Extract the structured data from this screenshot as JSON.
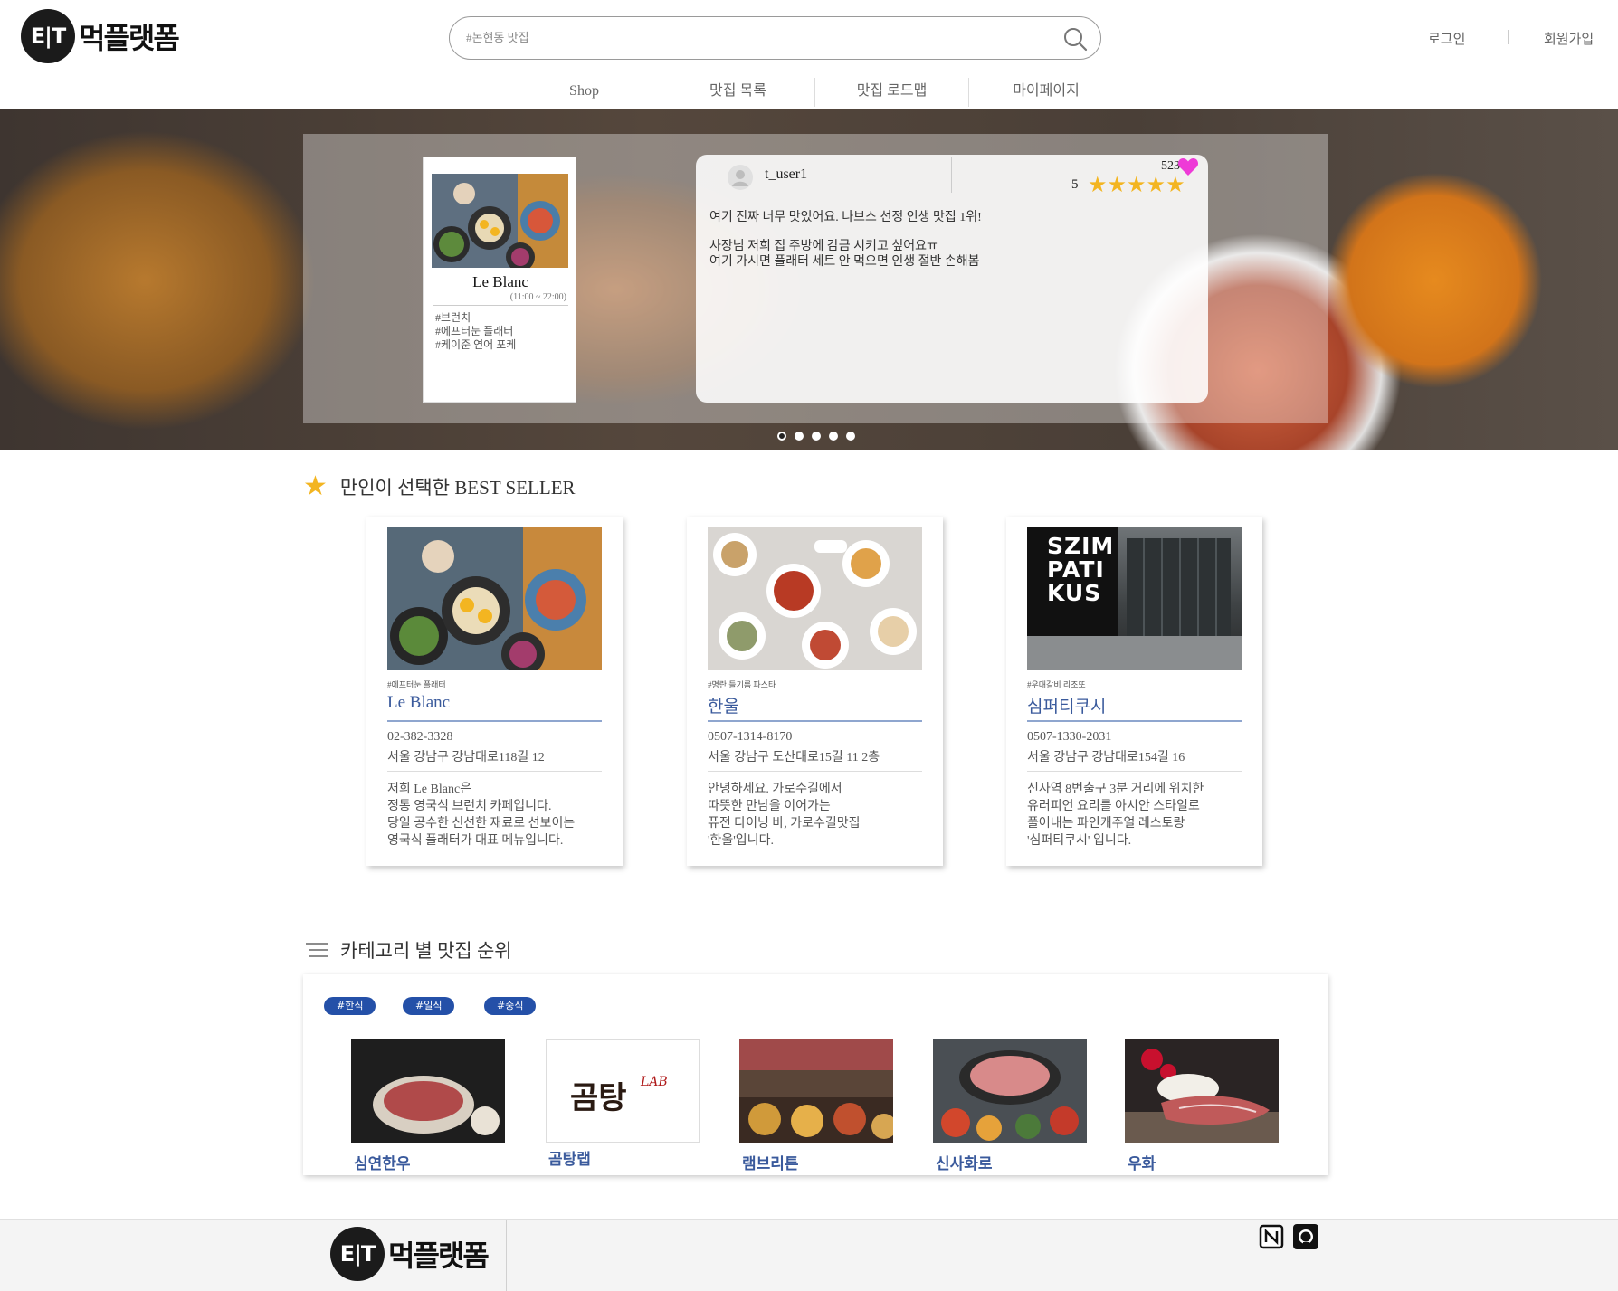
{
  "header": {
    "logo_mark": "E|T",
    "logo_text": "먹플랫폼",
    "search_placeholder": "#논현동 맛집",
    "login": "로그인",
    "signup": "회원가입",
    "nav": [
      "Shop",
      "맛집 목록",
      "맛집 로드맵",
      "마이페이지"
    ]
  },
  "hero": {
    "card": {
      "name": "Le Blanc",
      "hours": "(11:00 ~ 22:00)",
      "tags": [
        "#브런치",
        "#에프터눈 플래터",
        "#케이준 연어 포케"
      ]
    },
    "review": {
      "user": "t_user1",
      "likes": "523",
      "score": "5",
      "stars": 5,
      "lines": [
        "여기 진짜 너무 맛있어요. 나브스 선정 인생 맛집 1위!",
        "사장님 저희 집 주방에 감금 시키고 싶어요ㅠ\n여기 가시면 플래터 세트 안 먹으면 인생 절반 손해봄"
      ]
    },
    "slides": 5,
    "active_slide": 0
  },
  "best_seller": {
    "title": "만인이 선택한 BEST SELLER",
    "cards": [
      {
        "tag": "#에프터눈 플래터",
        "name": "Le Blanc",
        "phone": "02-382-3328",
        "address": "서울 강남구 강남대로118길 12",
        "desc": "저희 Le Blanc은\n정통 영국식 브런치 카페입니다.\n당일 공수한 신선한 재료로 선보이는\n영국식 플래터가 대표 메뉴입니다."
      },
      {
        "tag": "#명란 들기름 파스타",
        "name": "한울",
        "phone": "0507-1314-8170",
        "address": "서울 강남구 도산대로15길 11 2층",
        "desc": "안녕하세요. 가로수길에서\n따뜻한 만남을 이어가는\n퓨전 다이닝 바, 가로수길맛집\n'한울'입니다."
      },
      {
        "tag": "#우대갈비 리조또",
        "name": "심퍼티쿠시",
        "phone": "0507-1330-2031",
        "address": "서울 강남구 강남대로154길 16",
        "desc": "신사역 8번출구 3분 거리에 위치한\n유러피언 요리를 아시안 스타일로\n풀어내는 파인캐주얼 레스토랑\n'심퍼티쿠시' 입니다.",
        "sign_text": "SZIM\nPATI\nKUS"
      }
    ]
  },
  "category": {
    "title": "카테고리 별 맛집 순위",
    "chips": [
      "#한식",
      "#일식",
      "#중식"
    ],
    "items": [
      {
        "name": "심연한우"
      },
      {
        "name": "곰탕랩",
        "logo_main": "곰탕",
        "logo_sub": "LAB"
      },
      {
        "name": "램브리튼"
      },
      {
        "name": "신사화로"
      },
      {
        "name": "우화"
      }
    ]
  },
  "footer": {
    "logo_mark": "E|T",
    "logo_text": "먹플랫폼",
    "icons": [
      "notion-icon",
      "github-icon"
    ]
  },
  "colors": {
    "accent_blue": "#2450a8",
    "title_blue": "#3a5a9c",
    "star": "#f3b521",
    "heart": "#ee3ad7"
  }
}
